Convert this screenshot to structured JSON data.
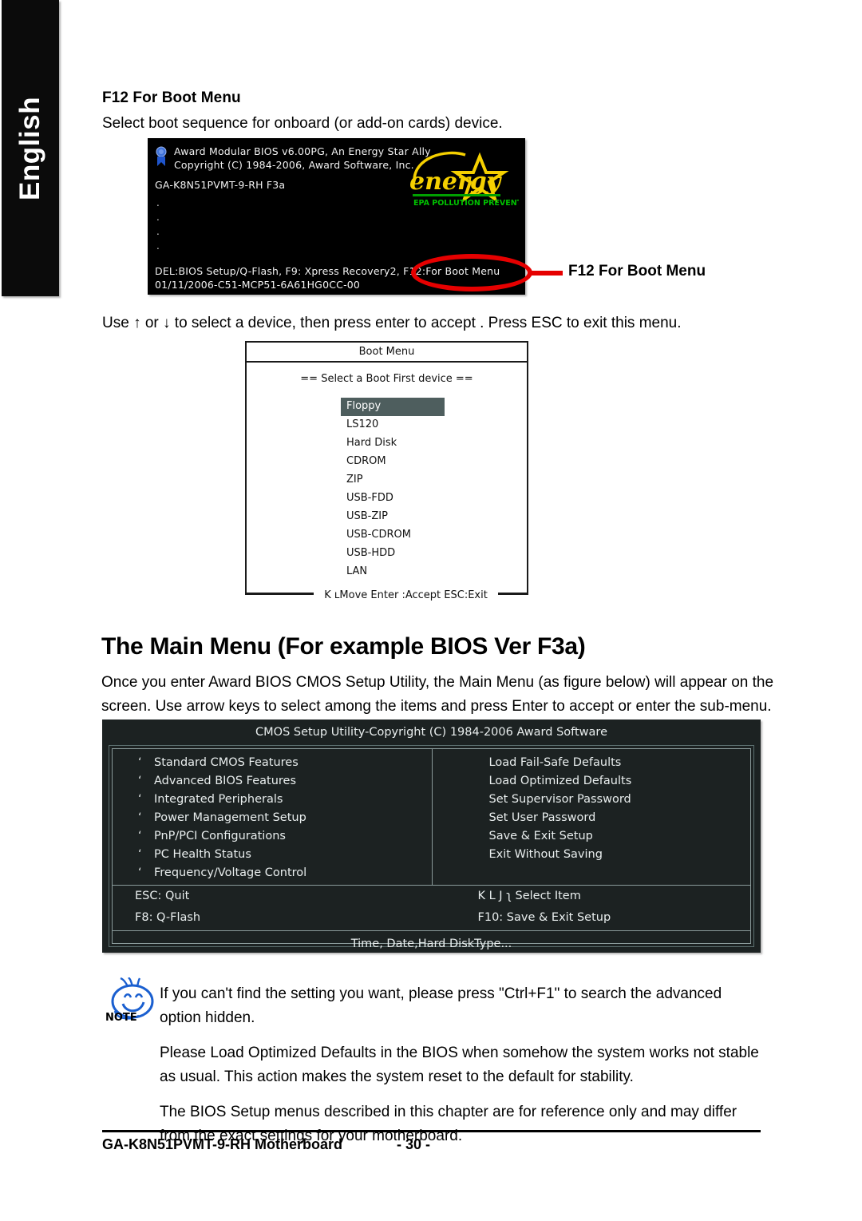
{
  "sidebar": {
    "language": "English"
  },
  "section": {
    "heading": "F12  For Boot Menu",
    "description": "Select boot sequence for onboard (or add-on cards) device."
  },
  "post_screen": {
    "line1": "Award Modular BIOS v6.00PG, An Energy Star Ally",
    "line2": "Copyright (C) 1984-2006, Award Software, Inc.",
    "line3": "GA-K8N51PVMT-9-RH F3a",
    "dots": [
      ".",
      ".",
      ".",
      "."
    ],
    "line4": "DEL:BIOS Setup/Q-Flash, F9: Xpress Recovery2, F12:For Boot Menu",
    "line5": "01/11/2006-C51-MCP51-6A61HG0CC-00",
    "energy_logo": {
      "word": "energy",
      "tagline": "EPA  POLLUTION PREVENTER"
    }
  },
  "callout": {
    "label": "F12 For Boot Menu"
  },
  "instruction": "Use   ↑ or    ↓ to select a device, then press enter to accept . Press ESC to exit this menu.",
  "boot_menu": {
    "title": "Boot Menu",
    "subtitle": "==  Select a Boot First device  ==",
    "items": [
      "Floppy",
      "LS120",
      "Hard Disk",
      "CDROM",
      "ZIP",
      "USB-FDD",
      "USB-ZIP",
      "USB-CDROM",
      "USB-HDD",
      "LAN"
    ],
    "selected_index": 0,
    "hint": "K ʟMove  Enter :Accept  ESC:Exit"
  },
  "main_menu_section": {
    "heading": "The Main Menu (For example BIOS Ver  F3a)",
    "paragraph_line1": "Once you enter Award BIOS CMOS Setup Utility, the Main Menu (as figure below) will appear on the",
    "paragraph_line2": "screen.  Use arrow keys to select among the items and press Enter to accept or enter the sub-menu."
  },
  "cmos": {
    "title": "CMOS Setup Utility-Copyright (C) 1984-2006 Award Software",
    "bullet": "‘",
    "left_items": [
      "Standard CMOS Features",
      "Advanced BIOS Features",
      "Integrated Peripherals",
      "Power Management Setup",
      "PnP/PCI Configurations",
      "PC Health Status",
      "Frequency/Voltage Control"
    ],
    "right_items": [
      "Load Fail-Safe Defaults",
      "Load Optimized Defaults",
      "Set Supervisor Password",
      "Set User Password",
      "Save & Exit Setup",
      "Exit Without Saving"
    ],
    "keys": [
      {
        "left": "ESC: Quit",
        "right": "K L J ʅ Select Item"
      },
      {
        "left": "F8: Q-Flash",
        "right": "F10: Save & Exit Setup"
      }
    ],
    "status": "Time, Date,Hard DiskType..."
  },
  "note": {
    "label": "NOTE",
    "paragraph1": "If you can't find the setting you want, please press \"Ctrl+F1\" to search the advanced option hidden.",
    "paragraph2": "Please Load Optimized Defaults in the BIOS when somehow the system works not stable as usual. This action makes the system reset to the default for stability.",
    "paragraph3": "The BIOS Setup menus described in this chapter are for reference only and may differ from the exact settings for your motherboard."
  },
  "footer": {
    "product": "GA-K8N51PVMT-9-RH Motherboard",
    "page": "- 30 -"
  },
  "colors": {
    "sidebar_bg": "#0b0b0b",
    "post_bg": "#000000",
    "annotation_red": "#e60000",
    "cmos_bg": "#1c2222",
    "selection_bg": "#4e5e5e",
    "energy_yellow": "#f5d000",
    "energy_green": "#00a000",
    "note_blue": "#1a5fd0"
  }
}
